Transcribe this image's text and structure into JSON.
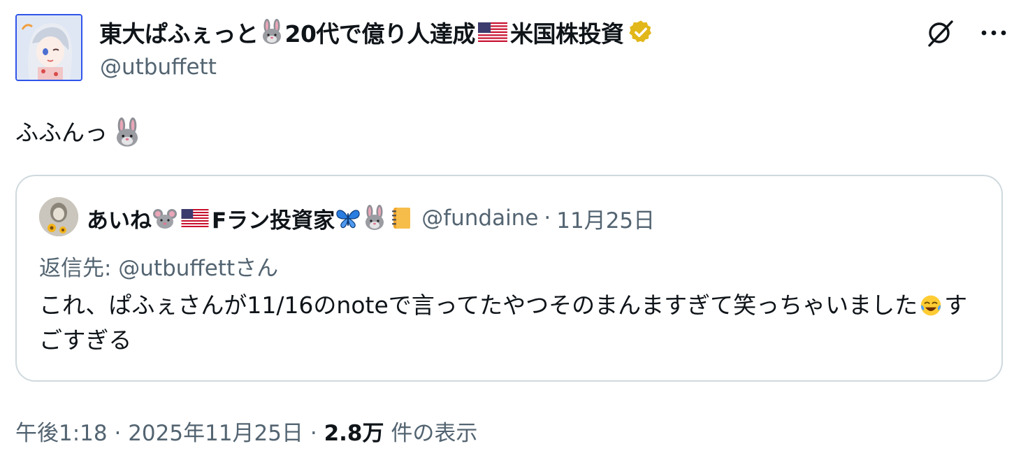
{
  "author": {
    "display_name_part1": "東大ぱふぇっと",
    "display_name_part2": "20代で億り人達成",
    "display_name_part3": "米国株投資",
    "handle": "@utbuffett",
    "emojis": [
      "rabbit-icon",
      "us-flag-icon",
      "verified-badge-icon"
    ]
  },
  "toolbar": {
    "grok_icon": "grok-icon",
    "more_icon": "more-icon"
  },
  "tweet": {
    "text": "ふふんっ",
    "trailing_emoji": "rabbit-icon"
  },
  "quote": {
    "name_part1": "あいね",
    "name_part2": "Fラン投資家",
    "handle": "@fundaine",
    "separator": "·",
    "date": "11月25日",
    "reply_to": "返信先: @utbuffettさん",
    "body_part1": "これ、ぱふぇさんが11/16のnoteで言ってたやつそのまんますぎて笑っちゃいました",
    "body_part2": "すごすぎる",
    "emojis": [
      "mouse-icon",
      "us-flag-icon",
      "butterfly-icon",
      "rabbit-icon",
      "notebook-icon",
      "tears-of-joy-icon"
    ]
  },
  "footer": {
    "time": "午後1:18",
    "sep1": "·",
    "date": "2025年11月25日",
    "sep2": "·",
    "views_count": "2.8万",
    "views_label": "件の表示"
  },
  "colors": {
    "text_primary": "#0f1419",
    "text_secondary": "#536471",
    "border": "#cfd9de",
    "verified_gold": "#e2b719"
  }
}
